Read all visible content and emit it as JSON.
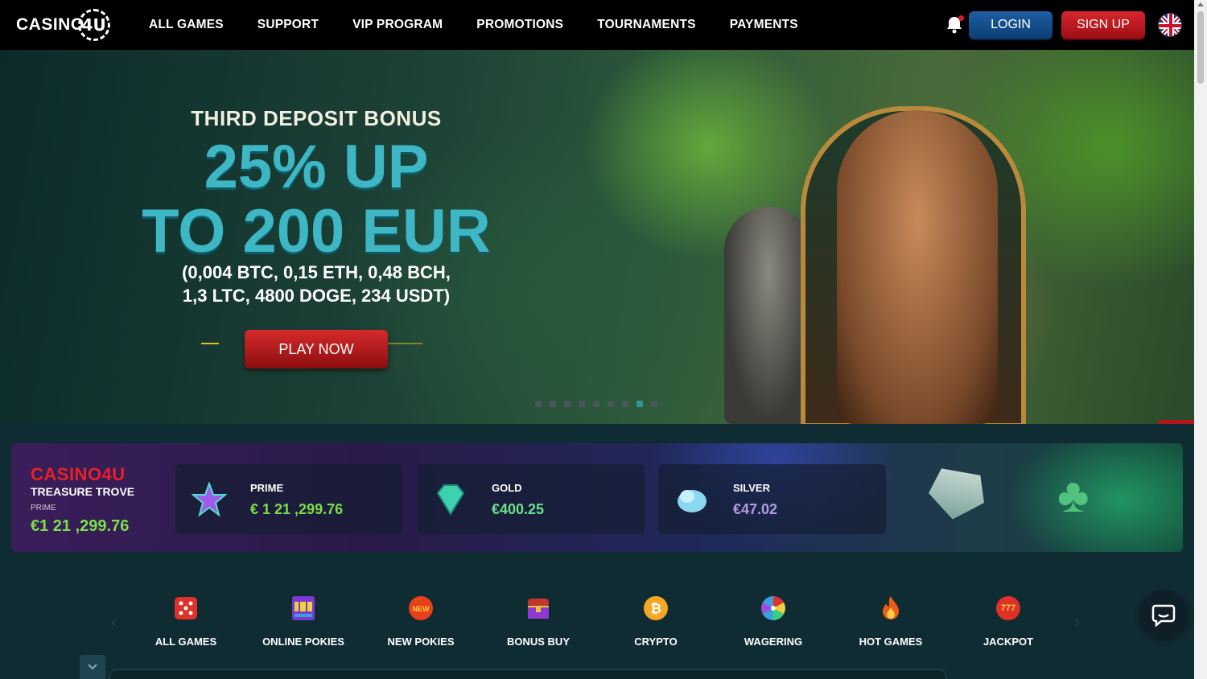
{
  "header": {
    "logo_text": "CASINO",
    "logo_chip": "4U",
    "nav": [
      "ALL GAMES",
      "SUPPORT",
      "VIP PROGRAM",
      "PROMOTIONS",
      "TOURNAMENTS",
      "PAYMENTS"
    ],
    "login_label": "LOGIN",
    "signup_label": "SIGN UP"
  },
  "hero": {
    "subtitle": "THIRD DEPOSIT BONUS",
    "big_line1": "25% UP",
    "big_line2": "TO 200 EUR",
    "crypto_line1": "(0,004 BTC, 0,15 ETH, 0,48 BCH,",
    "crypto_line2": "1,3 LTC, 4800 DOGE, 234 USDT)",
    "cta_label": "PLAY NOW",
    "slide_count": 9,
    "active_slide": 8
  },
  "jackpot": {
    "brand": "CASINO4U",
    "title": "TREASURE TROVE",
    "tier": "PRIME",
    "amount": "€1 21 ,299.76",
    "cards": [
      {
        "label": "PRIME",
        "amount": "€ 1 21 ,299.76",
        "color": "#7dde4a",
        "icon": "star-icon"
      },
      {
        "label": "GOLD",
        "amount": "€400.25",
        "color": "#6ee08a",
        "icon": "diamond-icon"
      },
      {
        "label": "SILVER",
        "amount": "€47.02",
        "color": "#b49be8",
        "icon": "cloud-icon"
      }
    ]
  },
  "categories": [
    {
      "label": "ALL GAMES",
      "icon": "dice-icon"
    },
    {
      "label": "ONLINE POKIES",
      "icon": "slot-machine-icon"
    },
    {
      "label": "NEW POKIES",
      "icon": "new-badge-icon",
      "badge": "NEW"
    },
    {
      "label": "BONUS BUY",
      "icon": "treasure-chest-icon"
    },
    {
      "label": "CRYPTO",
      "icon": "bitcoin-icon"
    },
    {
      "label": "WAGERING",
      "icon": "wheel-icon"
    },
    {
      "label": "HOT GAMES",
      "icon": "fire-icon"
    },
    {
      "label": "JACKPOT",
      "icon": "jackpot-icon",
      "badge": "777"
    }
  ],
  "colors": {
    "accent_teal": "#3fb6c3",
    "login_blue": "#1e5ea3",
    "signup_red": "#d8262c",
    "jackpot_green": "#7dde4a"
  }
}
